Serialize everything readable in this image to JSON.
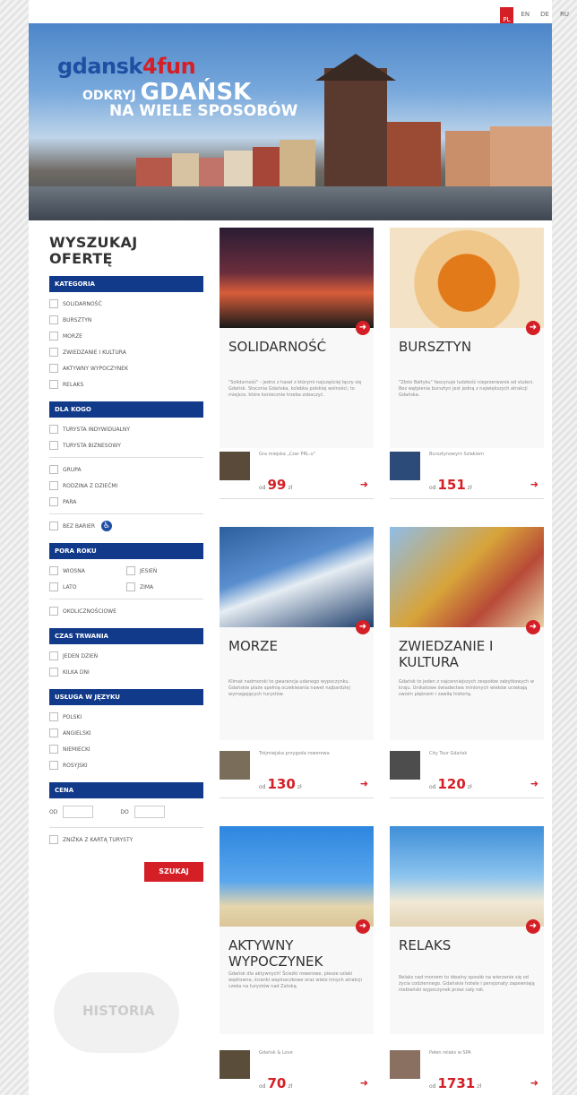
{
  "languages": [
    "PL",
    "EN",
    "DE",
    "RU"
  ],
  "hero": {
    "brand_a": "gdansk",
    "brand_b": "4fun",
    "tag_small": "ODKRYJ",
    "tag_big": "GDAŃSK",
    "tag2": "NA WIELE SPOSOBÓW"
  },
  "sidebar": {
    "title_line1": "WYSZUKAJ",
    "title_line2": "OFERTĘ",
    "kategoria": "KATEGORIA",
    "categories": [
      "SOLIDARNOŚĆ",
      "BURSZTYN",
      "MORZE",
      "ZWIEDZANIE I KULTURA",
      "AKTYWNY WYPOCZYNEK",
      "RELAKS"
    ],
    "dla_kogo": "DLA KOGO",
    "who": [
      "TURYSTA INDYWIDUALNY",
      "TURYSTA BIZNESOWY"
    ],
    "who2": [
      "GRUPA",
      "RODZINA Z DZIEĆMI",
      "PARA"
    ],
    "bez_barier": "BEZ BARIER",
    "pora_roku": "PORA ROKU",
    "seasons": [
      "WIOSNA",
      "JESIEŃ",
      "LATO",
      "ZIMA"
    ],
    "okolicznosciowe": "OKOLICZNOŚCIOWE",
    "czas_trwania": "CZAS TRWANIA",
    "durations": [
      "JEDEN DZIEŃ",
      "KILKA DNI"
    ],
    "usluga": "USŁUGA W JĘZYKU",
    "languages": [
      "POLSKI",
      "ANGIELSKI",
      "NIEMIECKI",
      "ROSYJSKI"
    ],
    "cena": "CENA",
    "od": "OD",
    "do": "DO",
    "karta": "ZNIŻKA Z KARTĄ TURYSTY",
    "search": "SZUKAJ",
    "cloud_word": "HISTORIA"
  },
  "cards": [
    {
      "title": "SOLIDARNOŚĆ",
      "title2": "",
      "desc": "\"Solidarność\" - jedno z haseł z którymi najczęściej łączy się Gdańsk. Stocznia Gdańska, kolebka polskiej wolności, to miejsce, które koniecznie trzeba zobaczyć.",
      "offer": "Gra miejska „Czar PRL-u\"",
      "od": "od",
      "price": "99",
      "zl": "zł",
      "color": "#2b1a2a",
      "accent": "#d45a3a"
    },
    {
      "title": "BURSZTYN",
      "title2": "",
      "desc": "\"Złoto Bałtyku\" fascynuje ludzkość nieprzerwanie od stuleci. Bez wątpienia bursztyn jest jedną z największych atrakcji Gdańska.",
      "offer": "Bursztynowym Szlakiem",
      "od": "od",
      "price": "151",
      "zl": "zł",
      "color": "#e2c49a",
      "accent": "#d85a10"
    },
    {
      "title": "MORZE",
      "title2": "",
      "desc": "Klimat nadmorski to gwarancja udanego wypoczynku. Gdańskie plaże spełnią oczekiwania nawet najbardziej wymagających turystów.",
      "offer": "Trójmiejska przygoda rowerowa",
      "od": "od",
      "price": "130",
      "zl": "zł",
      "color": "#3a73b8",
      "accent": "#dfe6ee"
    },
    {
      "title": "ZWIEDZANIE I",
      "title2": "KULTURA",
      "desc": "Gdańsk to jeden z najcenniejszych zespołów zabytkowych w kraju. Unikatowe świadectwa minionych wieków urzekają swoim pięknem i zawiłą historią.",
      "offer": "City Tour Gdańsk",
      "od": "od",
      "price": "120",
      "zl": "zł",
      "color": "#6aa0d8",
      "accent": "#c9a12a"
    },
    {
      "title": "AKTYWNY",
      "title2": "WYPOCZYNEK",
      "desc": "Gdańsk dla aktywnych! Ścieżki rowerowe, piesze szlaki wędrowne, ścianki wspinaczkowe oraz wiele innych atrakcji czeka na turystów nad Zatoką.",
      "offer": "Gdańsk & Love",
      "od": "od",
      "price": "70",
      "zl": "zł",
      "color": "#3f8fe0",
      "accent": "#e8d9b0"
    },
    {
      "title": "RELAKS",
      "title2": "",
      "desc": "Relaks nad morzem to idealny sposób na wierzanie się od życia codziennego. Gdańskie hotele i pensjonaty zapewniają niebiański wypoczynek przez cały rok.",
      "offer": "Pełen relaks w SPA",
      "od": "od",
      "price": "1731",
      "zl": "zł",
      "color": "#7ab8e6",
      "accent": "#e8dcc4"
    }
  ]
}
